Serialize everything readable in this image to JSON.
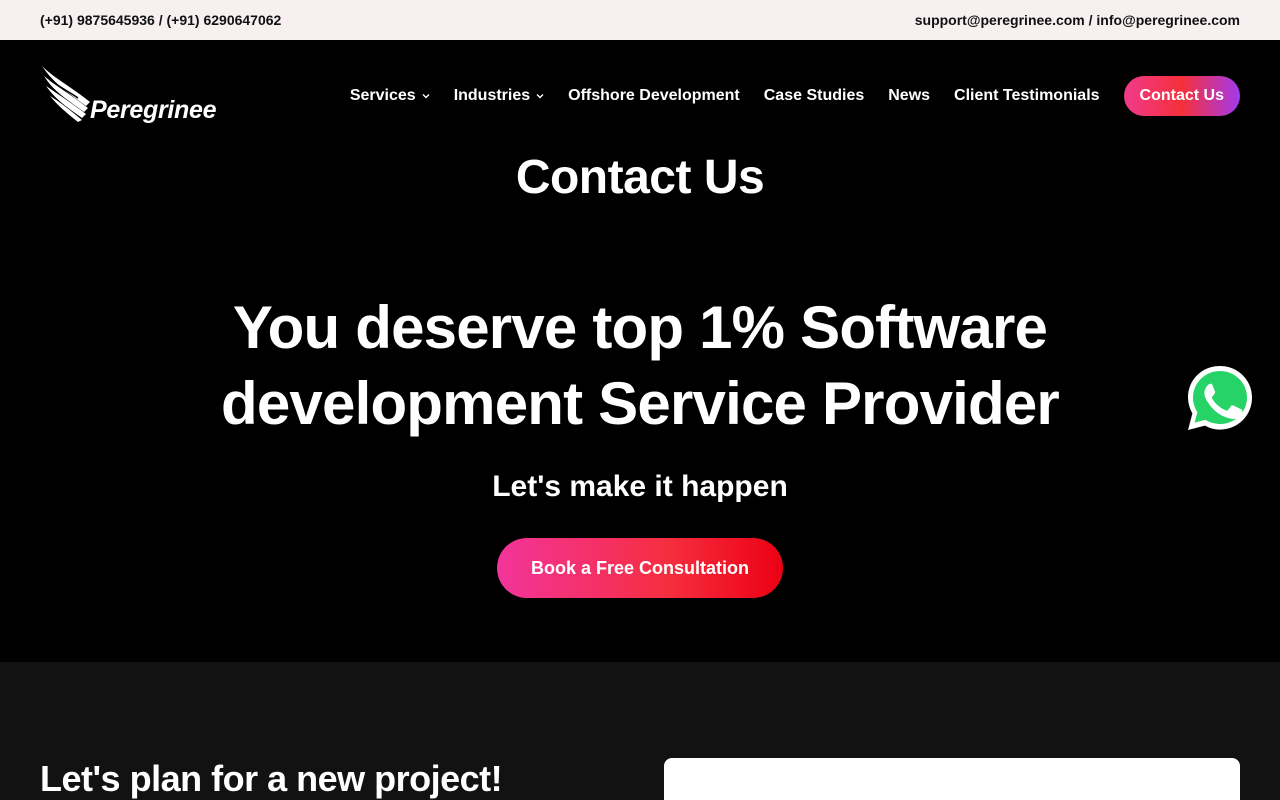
{
  "topbar": {
    "phones": "(+91) 9875645936 / (+91) 6290647062",
    "emails": "support@peregrinee.com / info@peregrinee.com"
  },
  "brand": {
    "name": "Peregrinee"
  },
  "nav": {
    "items": [
      {
        "label": "Services",
        "has_dropdown": true
      },
      {
        "label": "Industries",
        "has_dropdown": true
      },
      {
        "label": "Offshore Development",
        "has_dropdown": false
      },
      {
        "label": "Case Studies",
        "has_dropdown": false
      },
      {
        "label": "News",
        "has_dropdown": false
      },
      {
        "label": "Client Testimonials",
        "has_dropdown": false
      }
    ],
    "cta_label": "Contact Us"
  },
  "hero": {
    "page_title": "Contact Us",
    "heading_line1": "You deserve top 1% Software",
    "heading_line2": "development Service Provider",
    "subheading": "Let's make it happen",
    "button_label": "Book a Free Consultation"
  },
  "lower": {
    "heading": "Let's plan for a new project!"
  },
  "floating": {
    "icon": "whatsapp-icon"
  },
  "colors": {
    "topbar_bg": "#f7eff0",
    "page_bg": "#000000",
    "lower_bg": "#121212",
    "accent_pink": "#f3349b",
    "accent_red": "#ec0014",
    "accent_purple": "#a23aee",
    "whatsapp_green": "#25d366"
  }
}
